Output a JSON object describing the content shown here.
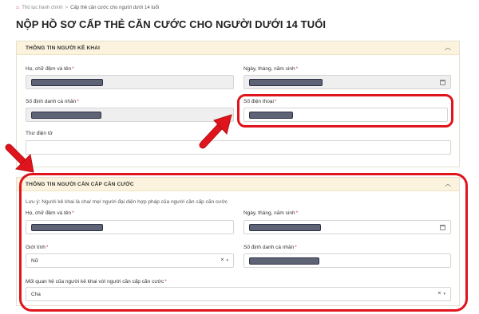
{
  "breadcrumb": {
    "home_label": "Thủ tục hành chính",
    "separator": ">",
    "current_label": "Cấp thẻ căn cước cho người dưới 14 tuổi"
  },
  "page_title": "NỘP HỒ SƠ CẤP THẺ CĂN CƯỚC CHO NGƯỜI DƯỚI 14 TUỔI",
  "declarant_section": {
    "title": "THÔNG TIN NGƯỜI KÊ KHAI",
    "full_name": {
      "label": "Họ, chữ đệm và tên",
      "required": "*",
      "value": ""
    },
    "dob": {
      "label": "Ngày, tháng, năm sinh",
      "required": "*",
      "value": ""
    },
    "id_number": {
      "label": "Số định danh cá nhân",
      "required": "*",
      "value": ""
    },
    "phone": {
      "label": "Số điện thoại",
      "required": "*",
      "value": ""
    },
    "email": {
      "label": "Thư điện tử",
      "value": ""
    }
  },
  "applicant_section": {
    "title": "THÔNG TIN NGƯỜI CẦN CẤP CĂN CƯỚC",
    "note": "Lưu ý: Người kê khai là cha/ mẹ/ người đại diện hợp pháp của người cần cấp căn cước",
    "full_name": {
      "label": "Họ, chữ đệm và tên",
      "required": "*",
      "value": ""
    },
    "dob": {
      "label": "Ngày, tháng, năm sinh",
      "required": "*",
      "value": ""
    },
    "gender": {
      "label": "Giới tính",
      "required": "*",
      "value": "Nữ"
    },
    "id_number": {
      "label": "Số định danh cá nhân",
      "required": "*",
      "value": ""
    },
    "relationship": {
      "label": "Mối quan hệ của người kê khai với người cần cấp căn cước",
      "required": "*",
      "value": "Cha"
    }
  },
  "icons": {
    "home": "home-icon",
    "collapse": "chevron-up-icon",
    "calendar": "calendar-icon",
    "clear": "clear-icon",
    "caret": "caret-down-icon"
  },
  "colors": {
    "accent_red": "#e0141c",
    "section_header_bg": "#fbf3dd",
    "required_star": "#d9342b"
  }
}
